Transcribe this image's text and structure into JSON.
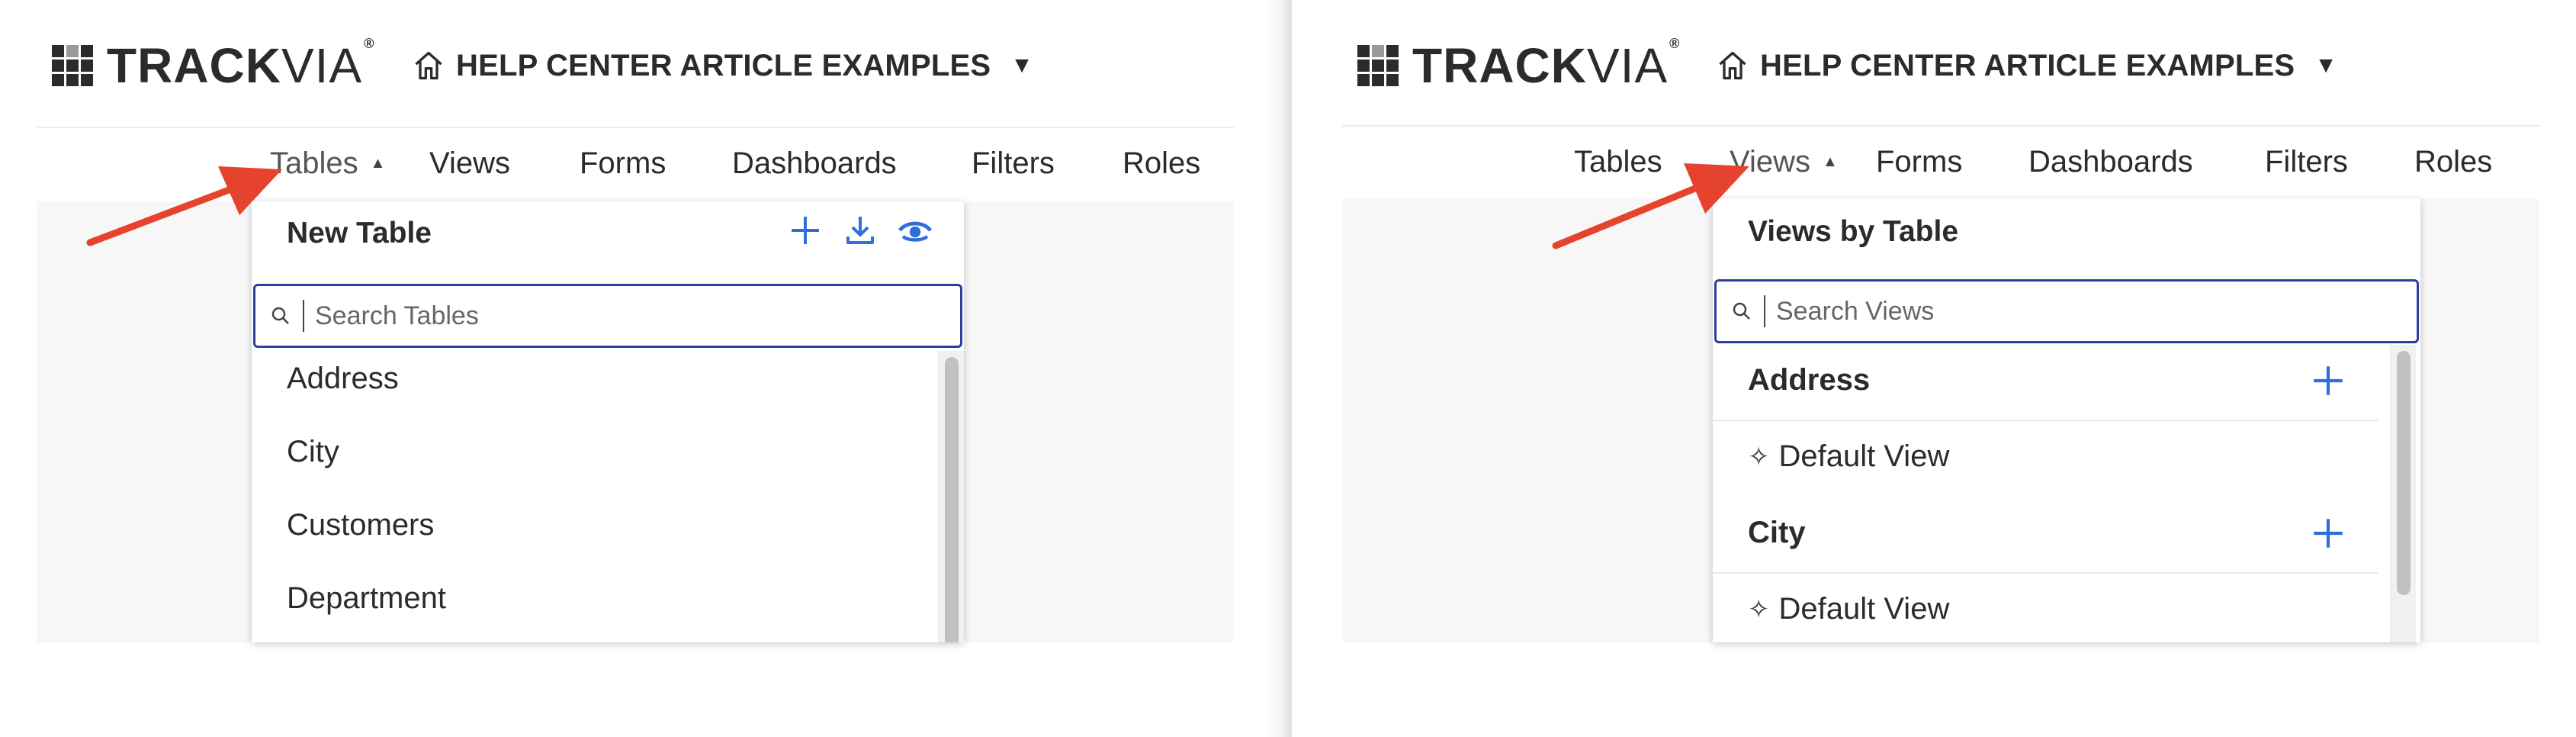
{
  "colors": {
    "accent_blue": "#2f6fdb",
    "search_border": "#2e3e9c",
    "arrow_red": "#e5432d",
    "text": "#2b2b2b"
  },
  "panels": [
    {
      "logo": {
        "bold": "TRACK",
        "thin": "VIA",
        "reg": "®"
      },
      "app_name": "HELP CENTER ARTICLE EXAMPLES",
      "nav": [
        "Tables",
        "Views",
        "Forms",
        "Dashboards",
        "Filters",
        "Roles"
      ],
      "active_nav": "Tables",
      "dropdown": {
        "title": "New Table",
        "action_icons": [
          "plus-icon",
          "download-icon",
          "eye-icon"
        ],
        "search_placeholder": "Search Tables",
        "items": [
          "Address",
          "City",
          "Customers",
          "Department"
        ]
      }
    },
    {
      "logo": {
        "bold": "TRACK",
        "thin": "VIA",
        "reg": "®"
      },
      "app_name": "HELP CENTER ARTICLE EXAMPLES",
      "nav": [
        "Tables",
        "Views",
        "Forms",
        "Dashboards",
        "Filters",
        "Roles"
      ],
      "active_nav": "Views",
      "dropdown": {
        "title": "Views by Table",
        "search_placeholder": "Search Views",
        "groups": [
          {
            "name": "Address",
            "views": [
              "Default View"
            ]
          },
          {
            "name": "City",
            "views": [
              "Default View"
            ]
          }
        ]
      }
    }
  ]
}
